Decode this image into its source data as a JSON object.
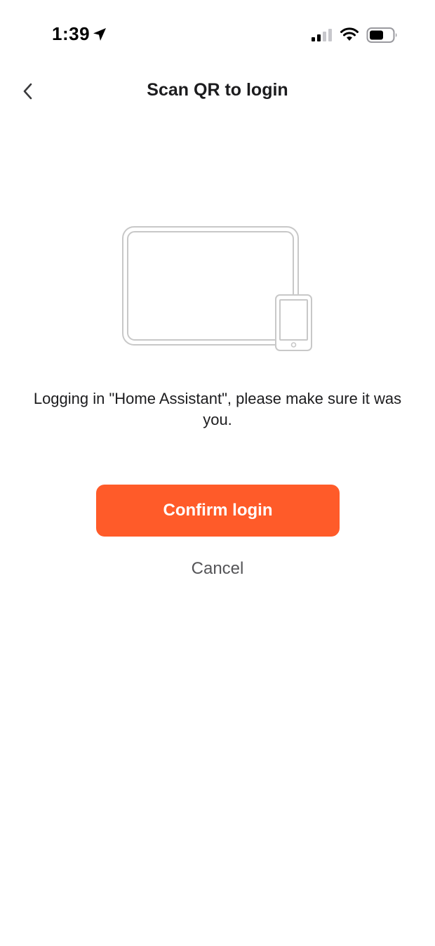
{
  "status_bar": {
    "time": "1:39",
    "icons": [
      "location-arrow-icon",
      "cellular-signal-icon",
      "wifi-icon",
      "battery-icon"
    ]
  },
  "nav": {
    "title": "Scan QR to login",
    "back_icon": "chevron-left-icon"
  },
  "illustration": {
    "icon": "tablet-and-phone-icon"
  },
  "message": "Logging in \"Home Assistant\", please make sure it was you.",
  "actions": {
    "confirm_label": "Confirm login",
    "cancel_label": "Cancel"
  },
  "colors": {
    "accent": "#ff5b29",
    "text": "#1c1c1e",
    "secondary_text": "#555558",
    "illustration_stroke": "#c8c8c8"
  }
}
